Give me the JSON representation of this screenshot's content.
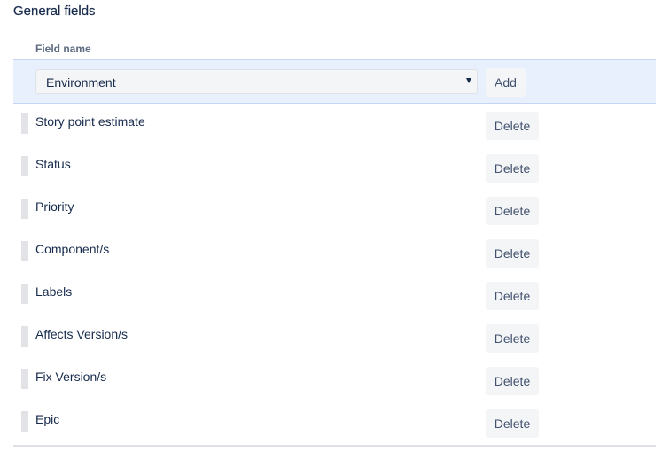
{
  "section": {
    "title": "General fields"
  },
  "table": {
    "column_header": "Field name"
  },
  "add_row": {
    "selected_field": "Environment",
    "caret_icon": "caret-down-icon",
    "add_label": "Add"
  },
  "fields": [
    {
      "label": "Story point estimate",
      "delete_label": "Delete"
    },
    {
      "label": "Status",
      "delete_label": "Delete"
    },
    {
      "label": "Priority",
      "delete_label": "Delete"
    },
    {
      "label": "Component/s",
      "delete_label": "Delete"
    },
    {
      "label": "Labels",
      "delete_label": "Delete"
    },
    {
      "label": "Affects Version/s",
      "delete_label": "Delete"
    },
    {
      "label": "Fix Version/s",
      "delete_label": "Delete"
    },
    {
      "label": "Epic",
      "delete_label": "Delete"
    }
  ],
  "colors": {
    "add_row_background": "#e9f0fd",
    "button_background": "#f4f5f7",
    "text": "#172b4d",
    "muted_text": "#5e6c84"
  }
}
